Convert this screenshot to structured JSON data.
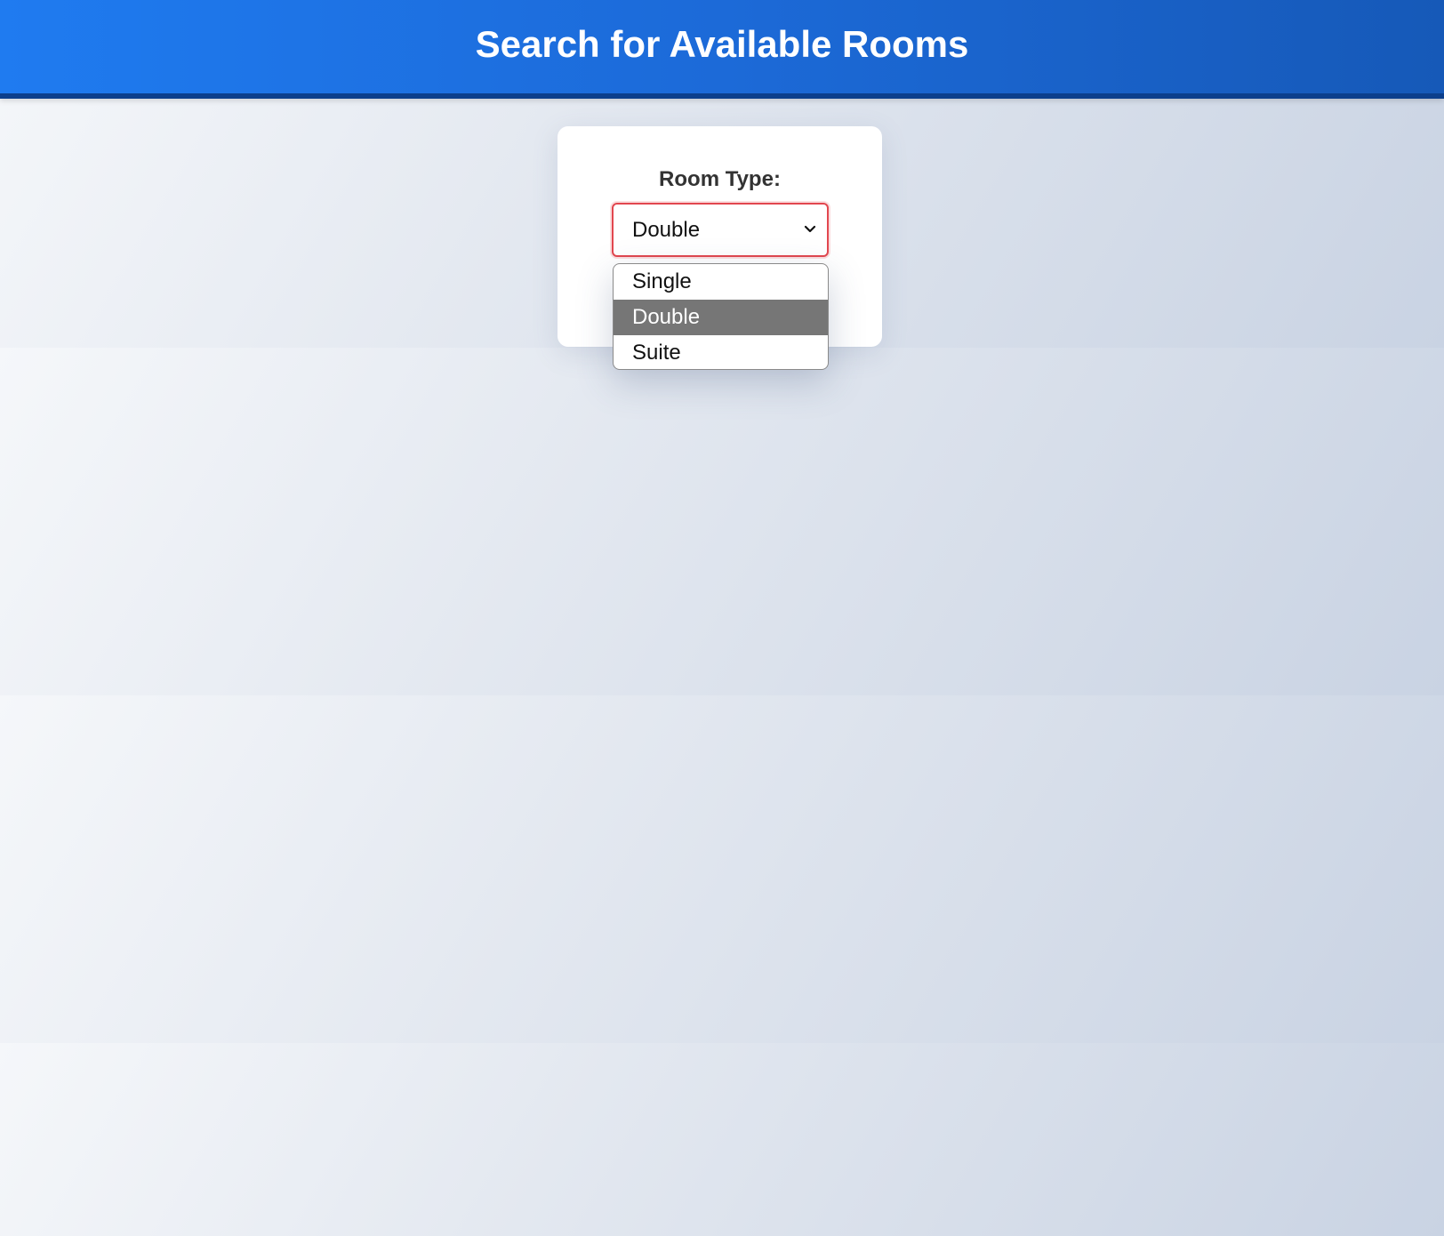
{
  "header": {
    "title": "Search for Available Rooms"
  },
  "form": {
    "room_type_label": "Room Type:",
    "room_type_select": {
      "selected_value": "Double",
      "options": [
        "Single",
        "Double",
        "Suite"
      ],
      "highlighted_option": "Double",
      "expanded": true,
      "chevron_icon": "chevron-down-icon"
    }
  },
  "colors": {
    "header_start": "#1f7bf0",
    "header_end": "#1659b8",
    "header_border": "#0c3f8c",
    "select_border": "#e2474f",
    "option_highlight": "#767676"
  }
}
